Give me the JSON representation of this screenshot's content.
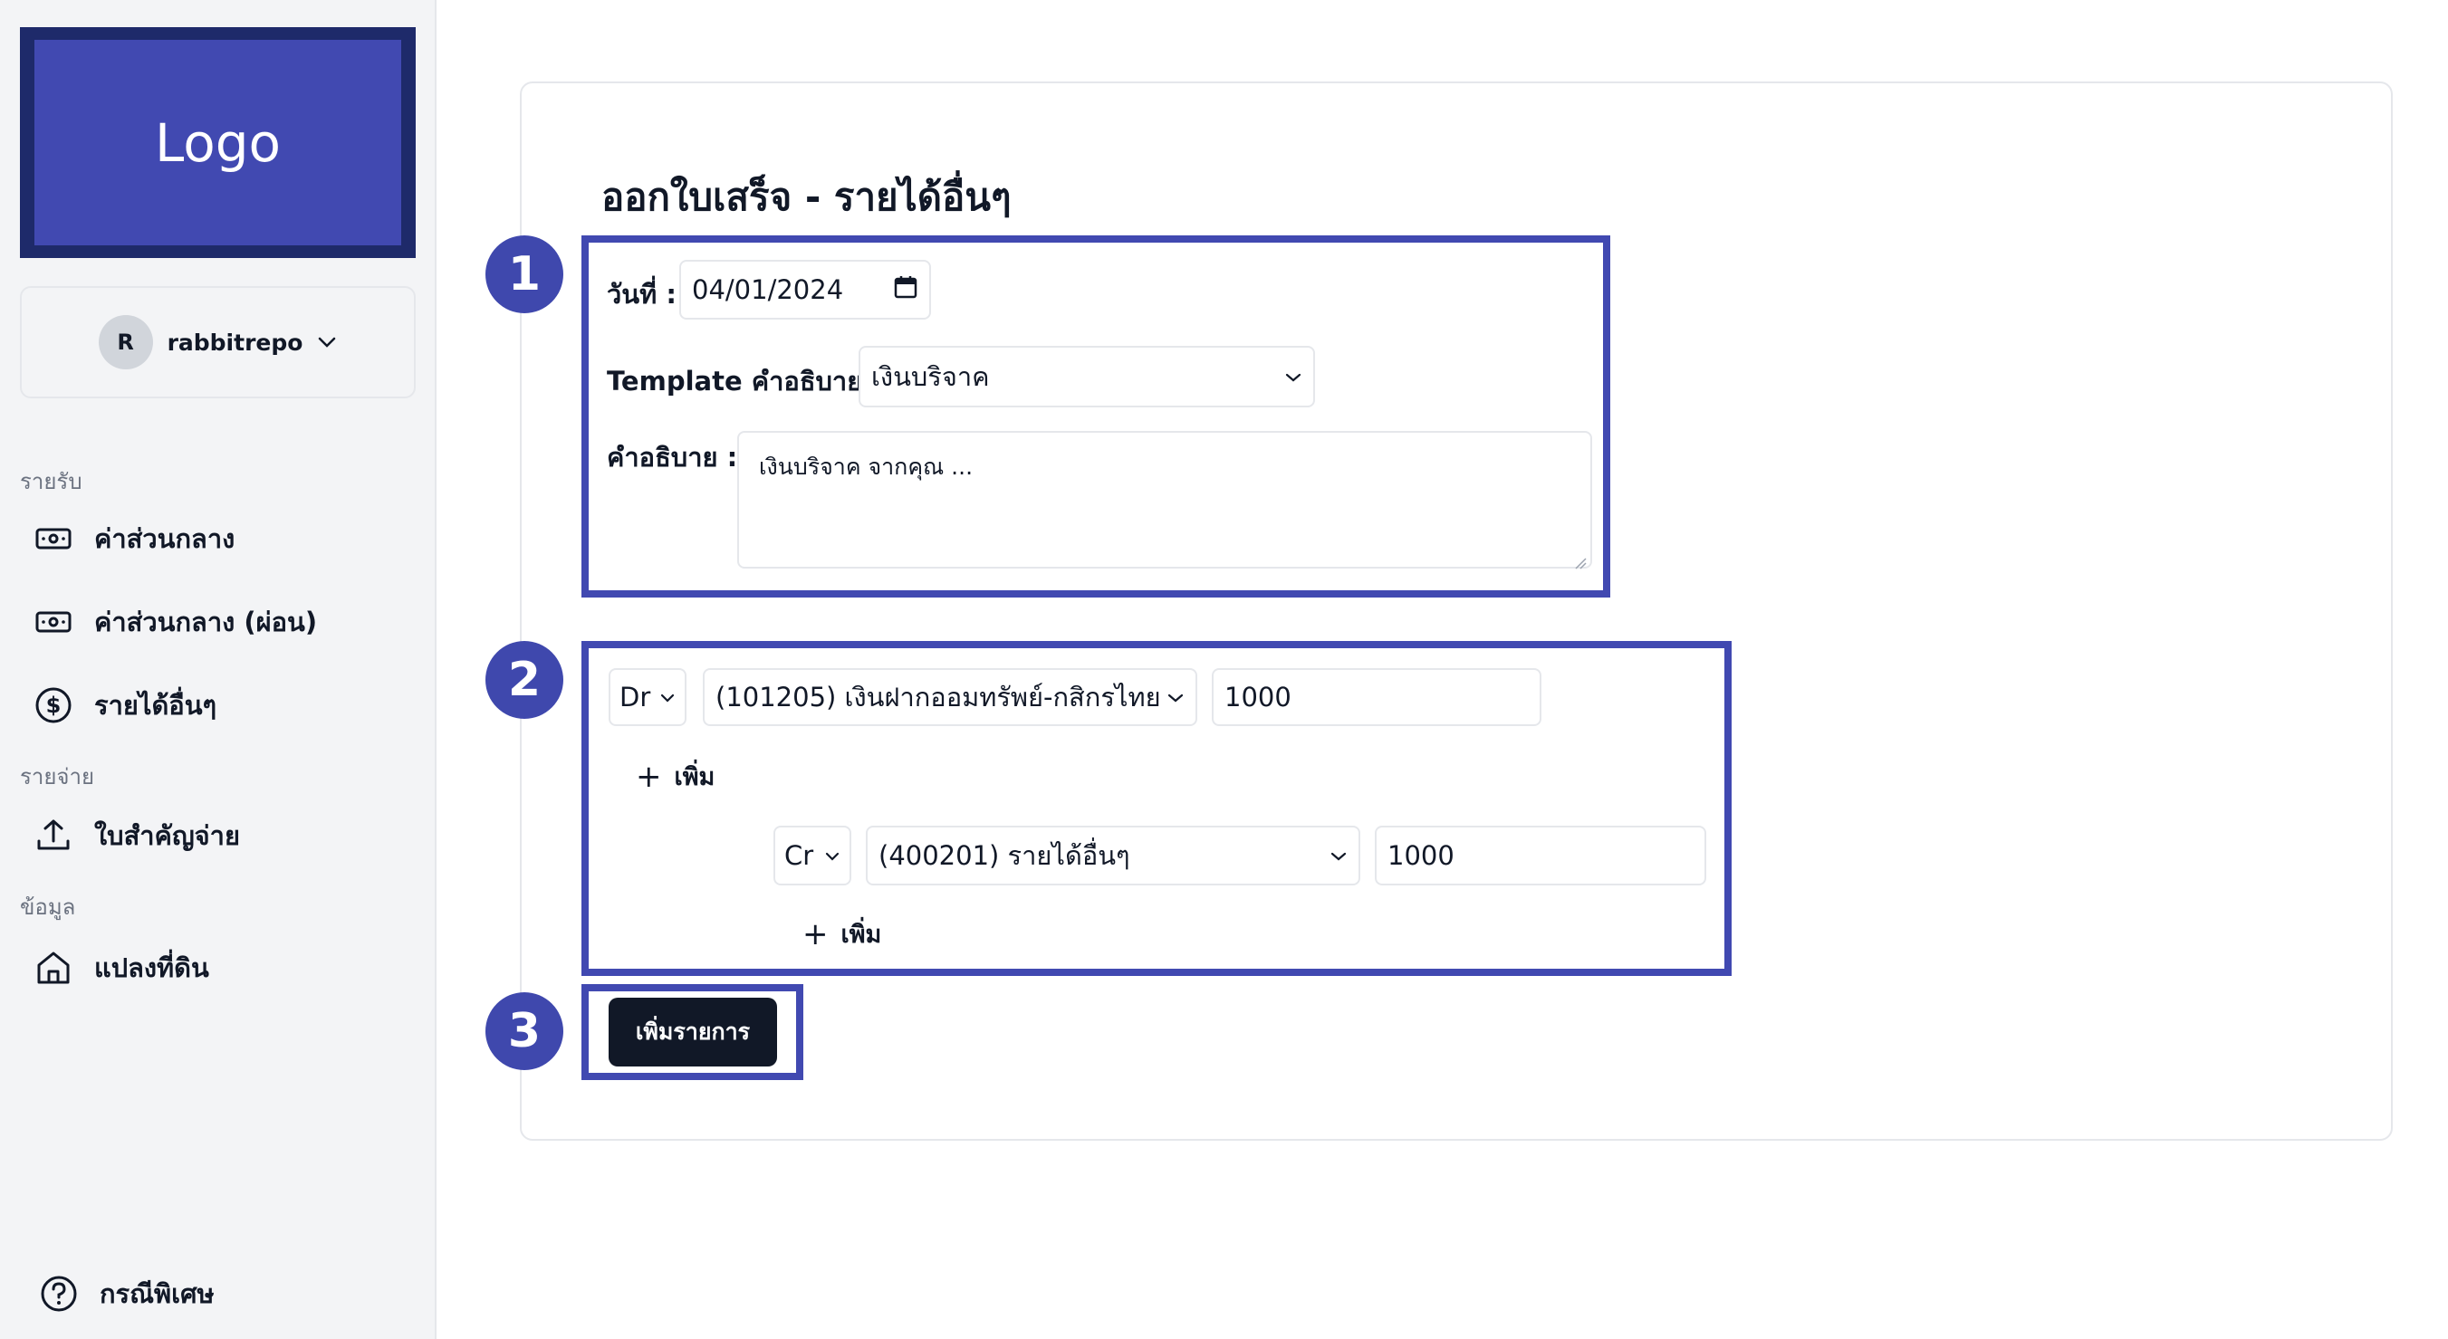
{
  "sidebar": {
    "logo": "Logo",
    "user": {
      "initial": "R",
      "name": "rabbitrepo"
    },
    "sections": [
      {
        "label": "รายรับ",
        "items": [
          {
            "label": "ค่าส่วนกลาง",
            "icon": "cash-icon"
          },
          {
            "label": "ค่าส่วนกลาง (ผ่อน)",
            "icon": "cash-icon"
          },
          {
            "label": "รายได้อื่นๆ",
            "icon": "dollar-circle-icon"
          }
        ]
      },
      {
        "label": "รายจ่าย",
        "items": [
          {
            "label": "ใบสำคัญจ่าย",
            "icon": "upload-icon"
          }
        ]
      },
      {
        "label": "ข้อมูล",
        "items": [
          {
            "label": "แปลงที่ดิน",
            "icon": "home-icon"
          }
        ]
      }
    ],
    "footer_item": {
      "label": "กรณีพิเศษ",
      "icon": "help-circle-icon"
    }
  },
  "main": {
    "title": "ออกใบเสร็จ - รายได้อื่นๆ",
    "badges": [
      "1",
      "2",
      "3"
    ],
    "form": {
      "date_label": "วันที่ :",
      "date_value": "04/01/2024",
      "template_label": "Template คำอธิบาย :",
      "template_value": "เงินบริจาค",
      "description_label": "คำอธิบาย :",
      "description_value": "เงินบริจาค จากคุณ ..."
    },
    "entries": {
      "debit": {
        "side": "Dr",
        "account": "(101205) เงินฝากออมทรัพย์-กสิกรไทย",
        "amount": "1000"
      },
      "debit_add": "เพิ่ม",
      "credit": {
        "side": "Cr",
        "account": "(400201) รายได้อื่นๆ",
        "amount": "1000"
      },
      "credit_add": "เพิ่ม"
    },
    "submit_label": "เพิ่มรายการ"
  },
  "colors": {
    "accent": "#4149b1",
    "badge": "#3f48ad",
    "button": "#111827"
  }
}
